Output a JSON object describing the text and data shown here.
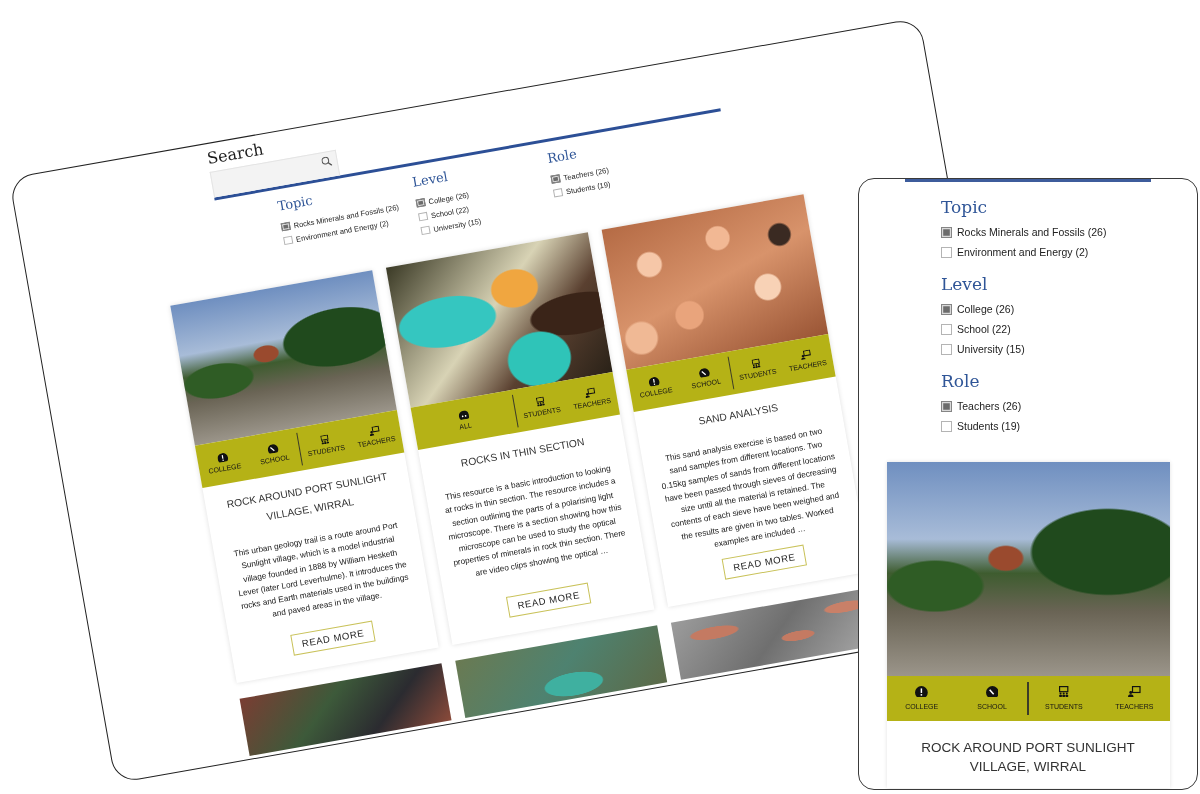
{
  "tablet": {
    "search": {
      "title": "Search"
    },
    "filters": [
      {
        "heading": "Topic",
        "options": [
          {
            "label": "Rocks Minerals and Fossils (26)",
            "checked": true
          },
          {
            "label": "Environment and Energy (2)",
            "checked": false
          }
        ]
      },
      {
        "heading": "Level",
        "options": [
          {
            "label": "College (26)",
            "checked": true
          },
          {
            "label": "School (22)",
            "checked": false
          },
          {
            "label": "University (15)",
            "checked": false
          }
        ]
      },
      {
        "heading": "Role",
        "options": [
          {
            "label": "Teachers (26)",
            "checked": true
          },
          {
            "label": "Students (19)",
            "checked": false
          }
        ]
      }
    ],
    "cards": [
      {
        "levels": [
          {
            "kind": "college",
            "label": "COLLEGE"
          },
          {
            "kind": "school",
            "label": "SCHOOL"
          }
        ],
        "roles": [
          {
            "kind": "students",
            "label": "STUDENTS"
          },
          {
            "kind": "teachers",
            "label": "TEACHERS"
          }
        ],
        "title": "ROCK AROUND PORT SUNLIGHT VILLAGE, WIRRAL",
        "description": "This urban geology trail is a route around Port Sunlight village, which is a model industrial village founded in 1888 by William Hesketh Lever (later Lord Leverhulme). It introduces the rocks and Earth materials used in the buildings and paved areas in the village.",
        "button": "READ MORE"
      },
      {
        "levels": [
          {
            "kind": "all",
            "label": "ALL"
          }
        ],
        "roles": [
          {
            "kind": "students",
            "label": "STUDENTS"
          },
          {
            "kind": "teachers",
            "label": "TEACHERS"
          }
        ],
        "title": "ROCKS IN THIN SECTION",
        "description": "This resource is a basic introduction to looking at rocks in thin section. The resource includes a section outlining the parts of a polarising light microscope. There is a section showing how this microscope can be used to study the optical properties of minerals in rock thin section. There are video clips showing the optical …",
        "button": "READ MORE"
      },
      {
        "levels": [
          {
            "kind": "college",
            "label": "COLLEGE"
          },
          {
            "kind": "school",
            "label": "SCHOOL"
          }
        ],
        "roles": [
          {
            "kind": "students",
            "label": "STUDENTS"
          },
          {
            "kind": "teachers",
            "label": "TEACHERS"
          }
        ],
        "title": "SAND ANALYSIS",
        "description": "This sand analysis exercise is based on two sand samples from different locations. Two 0.15kg samples of sands from different locations have been passed through sieves of decreasing size until all the material is retained. The contents of each sieve have been weighed and the results are given in two tables. Worked examples are included …",
        "button": "READ MORE"
      }
    ]
  },
  "phone": {
    "filters": [
      {
        "heading": "Topic",
        "options": [
          {
            "label": "Rocks Minerals and Fossils (26)",
            "checked": true
          },
          {
            "label": "Environment and Energy (2)",
            "checked": false
          }
        ]
      },
      {
        "heading": "Level",
        "options": [
          {
            "label": "College (26)",
            "checked": true
          },
          {
            "label": "School (22)",
            "checked": false
          },
          {
            "label": "University (15)",
            "checked": false
          }
        ]
      },
      {
        "heading": "Role",
        "options": [
          {
            "label": "Teachers (26)",
            "checked": true
          },
          {
            "label": "Students (19)",
            "checked": false
          }
        ]
      }
    ],
    "card": {
      "levels": [
        {
          "kind": "college",
          "label": "COLLEGE"
        },
        {
          "kind": "school",
          "label": "SCHOOL"
        }
      ],
      "roles": [
        {
          "kind": "students",
          "label": "STUDENTS"
        },
        {
          "kind": "teachers",
          "label": "TEACHERS"
        }
      ],
      "title": "ROCK AROUND PORT SUNLIGHT VILLAGE, WIRRAL"
    }
  }
}
